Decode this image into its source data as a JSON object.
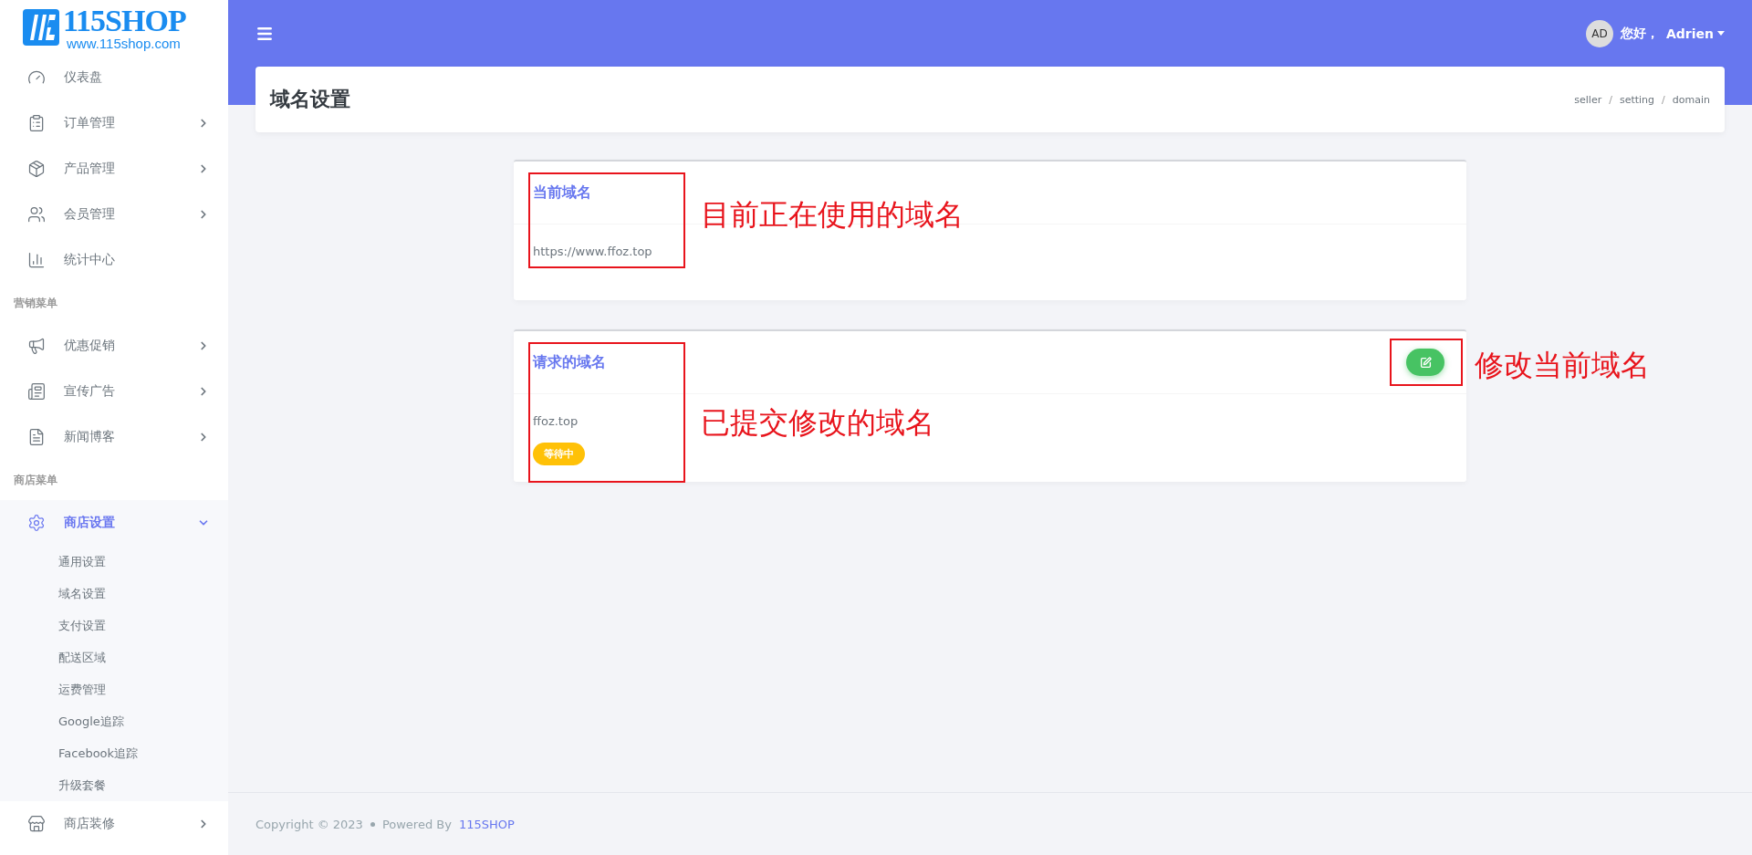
{
  "logo": {
    "name": "115SHOP",
    "url": "www.115shop.com"
  },
  "sidebar": {
    "sections": [
      {
        "items": [
          {
            "label": "仪表盘",
            "selected": false
          },
          {
            "label": "订单管理",
            "selected": false,
            "expanded": false
          },
          {
            "label": "产品管理",
            "selected": false,
            "expanded": false
          },
          {
            "label": "会员管理",
            "selected": false,
            "expanded": false
          },
          {
            "label": "统计中心",
            "selected": false
          }
        ]
      },
      {
        "heading": "营销菜单",
        "items": [
          {
            "label": "优惠促销",
            "selected": false,
            "expanded": false
          },
          {
            "label": "宣传广告",
            "selected": false,
            "expanded": false
          },
          {
            "label": "新闻博客",
            "selected": false,
            "expanded": false
          }
        ]
      },
      {
        "heading": "商店菜单",
        "items": [
          {
            "label": "商店设置",
            "selected": true,
            "expanded": true,
            "children": [
              {
                "label": "通用设置"
              },
              {
                "label": "域名设置"
              },
              {
                "label": "支付设置"
              },
              {
                "label": "配送区域"
              },
              {
                "label": "运费管理"
              },
              {
                "label": "Google追踪"
              },
              {
                "label": "Facebook追踪"
              },
              {
                "label": "升级套餐"
              }
            ]
          },
          {
            "label": "商店装修",
            "selected": false,
            "expanded": false
          }
        ]
      }
    ]
  },
  "topbar": {
    "avatar": "AD",
    "greeting": "您好，",
    "user": "Adrien"
  },
  "page": {
    "title": "域名设置",
    "breadcrumb": [
      {
        "kind": "link",
        "text": "seller"
      },
      {
        "kind": "separator",
        "text": "/"
      },
      {
        "kind": "link",
        "text": "setting"
      },
      {
        "kind": "separator",
        "text": "/"
      },
      {
        "kind": "link",
        "text": "domain"
      }
    ]
  },
  "cards": [
    {
      "title": "当前域名",
      "value": "https://www.ffoz.top",
      "annotation": "目前正在使用的域名"
    },
    {
      "title": "请求的域名",
      "value": "ffoz.top",
      "status": "等待中",
      "annotation": "已提交修改的域名",
      "button_annotation": "修改当前域名"
    }
  ],
  "footer": {
    "copyright": "Copyright © 2023",
    "powered": "Powered By",
    "brand": "115SHOP"
  }
}
